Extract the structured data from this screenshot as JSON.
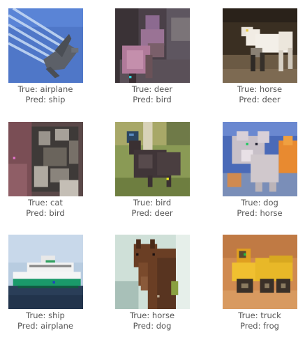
{
  "grid": {
    "cells": [
      {
        "subject": "airplane",
        "true_label": "True: airplane",
        "pred_label": "Pred: ship"
      },
      {
        "subject": "deer",
        "true_label": "True: deer",
        "pred_label": "Pred: bird"
      },
      {
        "subject": "horse",
        "true_label": "True: horse",
        "pred_label": "Pred: deer"
      },
      {
        "subject": "cat",
        "true_label": "True: cat",
        "pred_label": "Pred: bird"
      },
      {
        "subject": "bird",
        "true_label": "True: bird",
        "pred_label": "Pred: deer"
      },
      {
        "subject": "dog",
        "true_label": "True: dog",
        "pred_label": "Pred: horse"
      },
      {
        "subject": "ship",
        "true_label": "True: ship",
        "pred_label": "Pred: airplane"
      },
      {
        "subject": "horse",
        "true_label": "True: horse",
        "pred_label": "Pred: dog"
      },
      {
        "subject": "truck",
        "true_label": "True: truck",
        "pred_label": "Pred: frog"
      }
    ]
  },
  "colors": {
    "caption_text": "#555555",
    "background": "#ffffff"
  }
}
